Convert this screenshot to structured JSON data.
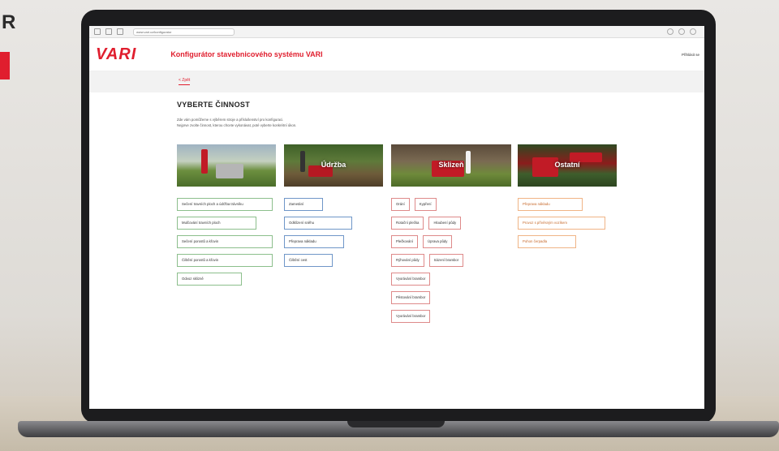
{
  "corner": {
    "letter": "R"
  },
  "browser": {
    "url": "www.vari.cz/konfigurator"
  },
  "header": {
    "logo": "VARI",
    "title": "Konfigurátor stavebnicového systému VARI",
    "login": "Přihlásit se"
  },
  "subnav": {
    "back": "< Zpět"
  },
  "main": {
    "heading": "VYBERTE ČINNOST",
    "intro_1": "Zde vám pomůžeme s výběrem stroje a příslušenství pro konfiguraci.",
    "intro_2": "Nejprve zvolte činnost, kterou chcete vykonávat, poté vyberte konkrétní úkon.",
    "categories": [
      {
        "label": ""
      },
      {
        "label": "Údržba"
      },
      {
        "label": "Sklizeň"
      },
      {
        "label": "Ostatní"
      }
    ],
    "col1": [
      "Sečení travních ploch a údržba trávníku",
      "Mulčování travních ploch",
      "Sečení porostů a křovin",
      "Čištění porostů a křovin",
      "Odvoz sklizně"
    ],
    "col2": [
      "Zametání",
      "Odklízení sněhu",
      "Přeprava nákladu",
      "Čištění cest"
    ],
    "col3_rows": [
      [
        "Orání",
        "Kypření"
      ],
      [
        "Rotační plečka",
        "Hloubení půdy"
      ],
      [
        "Plečkování",
        "Úprava půdy"
      ],
      [
        "Rýhování půdy",
        "Sázení brambor"
      ],
      [
        "Vyorávání brambor"
      ],
      [
        "Pěstování brambor"
      ],
      [
        "Vyorávání brambor"
      ]
    ],
    "col4": [
      "Přeprava nákladu",
      "Provoz s přívěsným vozíkem",
      "Pohon čerpadla"
    ]
  }
}
